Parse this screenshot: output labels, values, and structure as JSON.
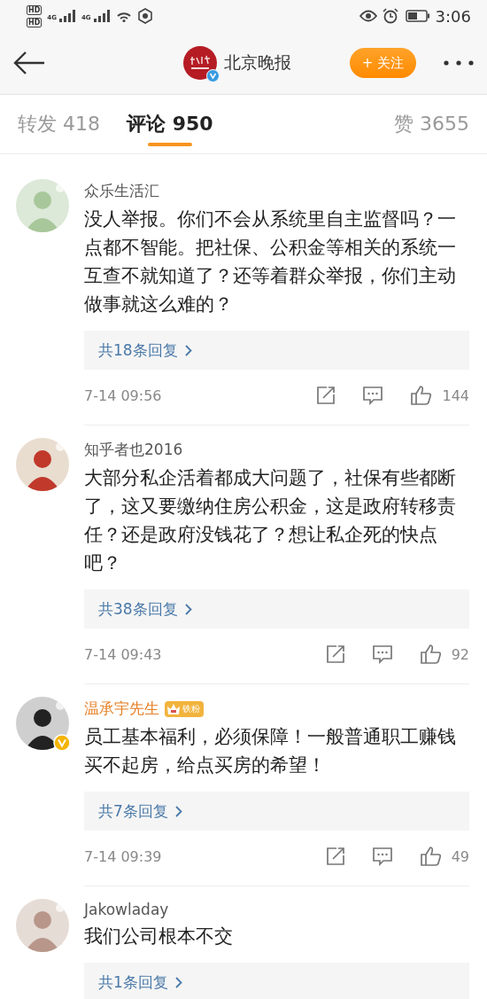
{
  "status_bar": {
    "sims": [
      {
        "hd": "HD",
        "net": "4G"
      },
      {
        "hd": "HD",
        "net": "4G"
      }
    ],
    "time": "3:06"
  },
  "header": {
    "account": "北京晚报",
    "verified": true,
    "follow": "+ 关注"
  },
  "tabs": [
    {
      "label": "转发 418",
      "selected": false
    },
    {
      "label": "评论 950",
      "selected": true
    },
    {
      "label": "赞 3655",
      "selected": false
    }
  ],
  "comments": [
    {
      "name": "众乐生活汇",
      "vip": false,
      "verified": false,
      "text": "没人举报。你们不会从系统里自主监督吗？一点都不智能。把社保、公积金等相关的系统一互查不就知道了？还等着群众举报，你们主动做事就这么难的？",
      "replies": "共18条回复",
      "time": "7-14 09:56",
      "likes": "144"
    },
    {
      "name": "知乎者也2016",
      "vip": false,
      "verified": false,
      "text": "大部分私企活着都成大问题了，社保有些都断了，这又要缴纳住房公积金，这是政府转移责任？还是政府没钱花了？想让私企死的快点吧？",
      "replies": "共38条回复",
      "time": "7-14 09:43",
      "likes": "92"
    },
    {
      "name": "温承宇先生",
      "vip": true,
      "badge": "铁粉",
      "verified": true,
      "text": "员工基本福利，必须保障！一般普通职工赚钱买不起房，给点买房的希望！",
      "replies": "共7条回复",
      "time": "7-14 09:39",
      "likes": "49"
    },
    {
      "name": "Jakowladay",
      "vip": false,
      "verified": false,
      "text": "我们公司根本不交",
      "replies": "共1条回复"
    }
  ]
}
